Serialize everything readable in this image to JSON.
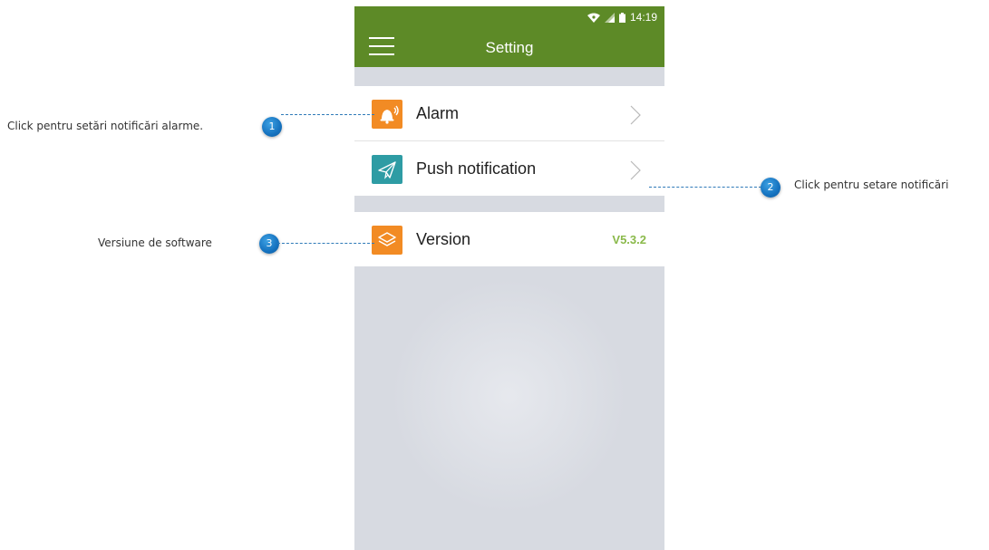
{
  "app": {
    "header_title": "Setting",
    "status_time": "14:19",
    "accent_color": "#5d8a27"
  },
  "settings": {
    "items": [
      {
        "label": "Alarm",
        "icon": "alarm-bell-icon",
        "icon_color": "#f28b24"
      },
      {
        "label": "Push notification",
        "icon": "paper-plane-icon",
        "icon_color": "#2e9ca4"
      },
      {
        "label": "Version",
        "icon": "layers-icon",
        "icon_color": "#f28b24",
        "value": "V5.3.2"
      }
    ]
  },
  "callouts": [
    {
      "number": "1",
      "text": "Click pentru setări notificări alarme."
    },
    {
      "number": "2",
      "text": "Click pentru setare notificări"
    },
    {
      "number": "3",
      "text": "Versiune de software"
    }
  ]
}
